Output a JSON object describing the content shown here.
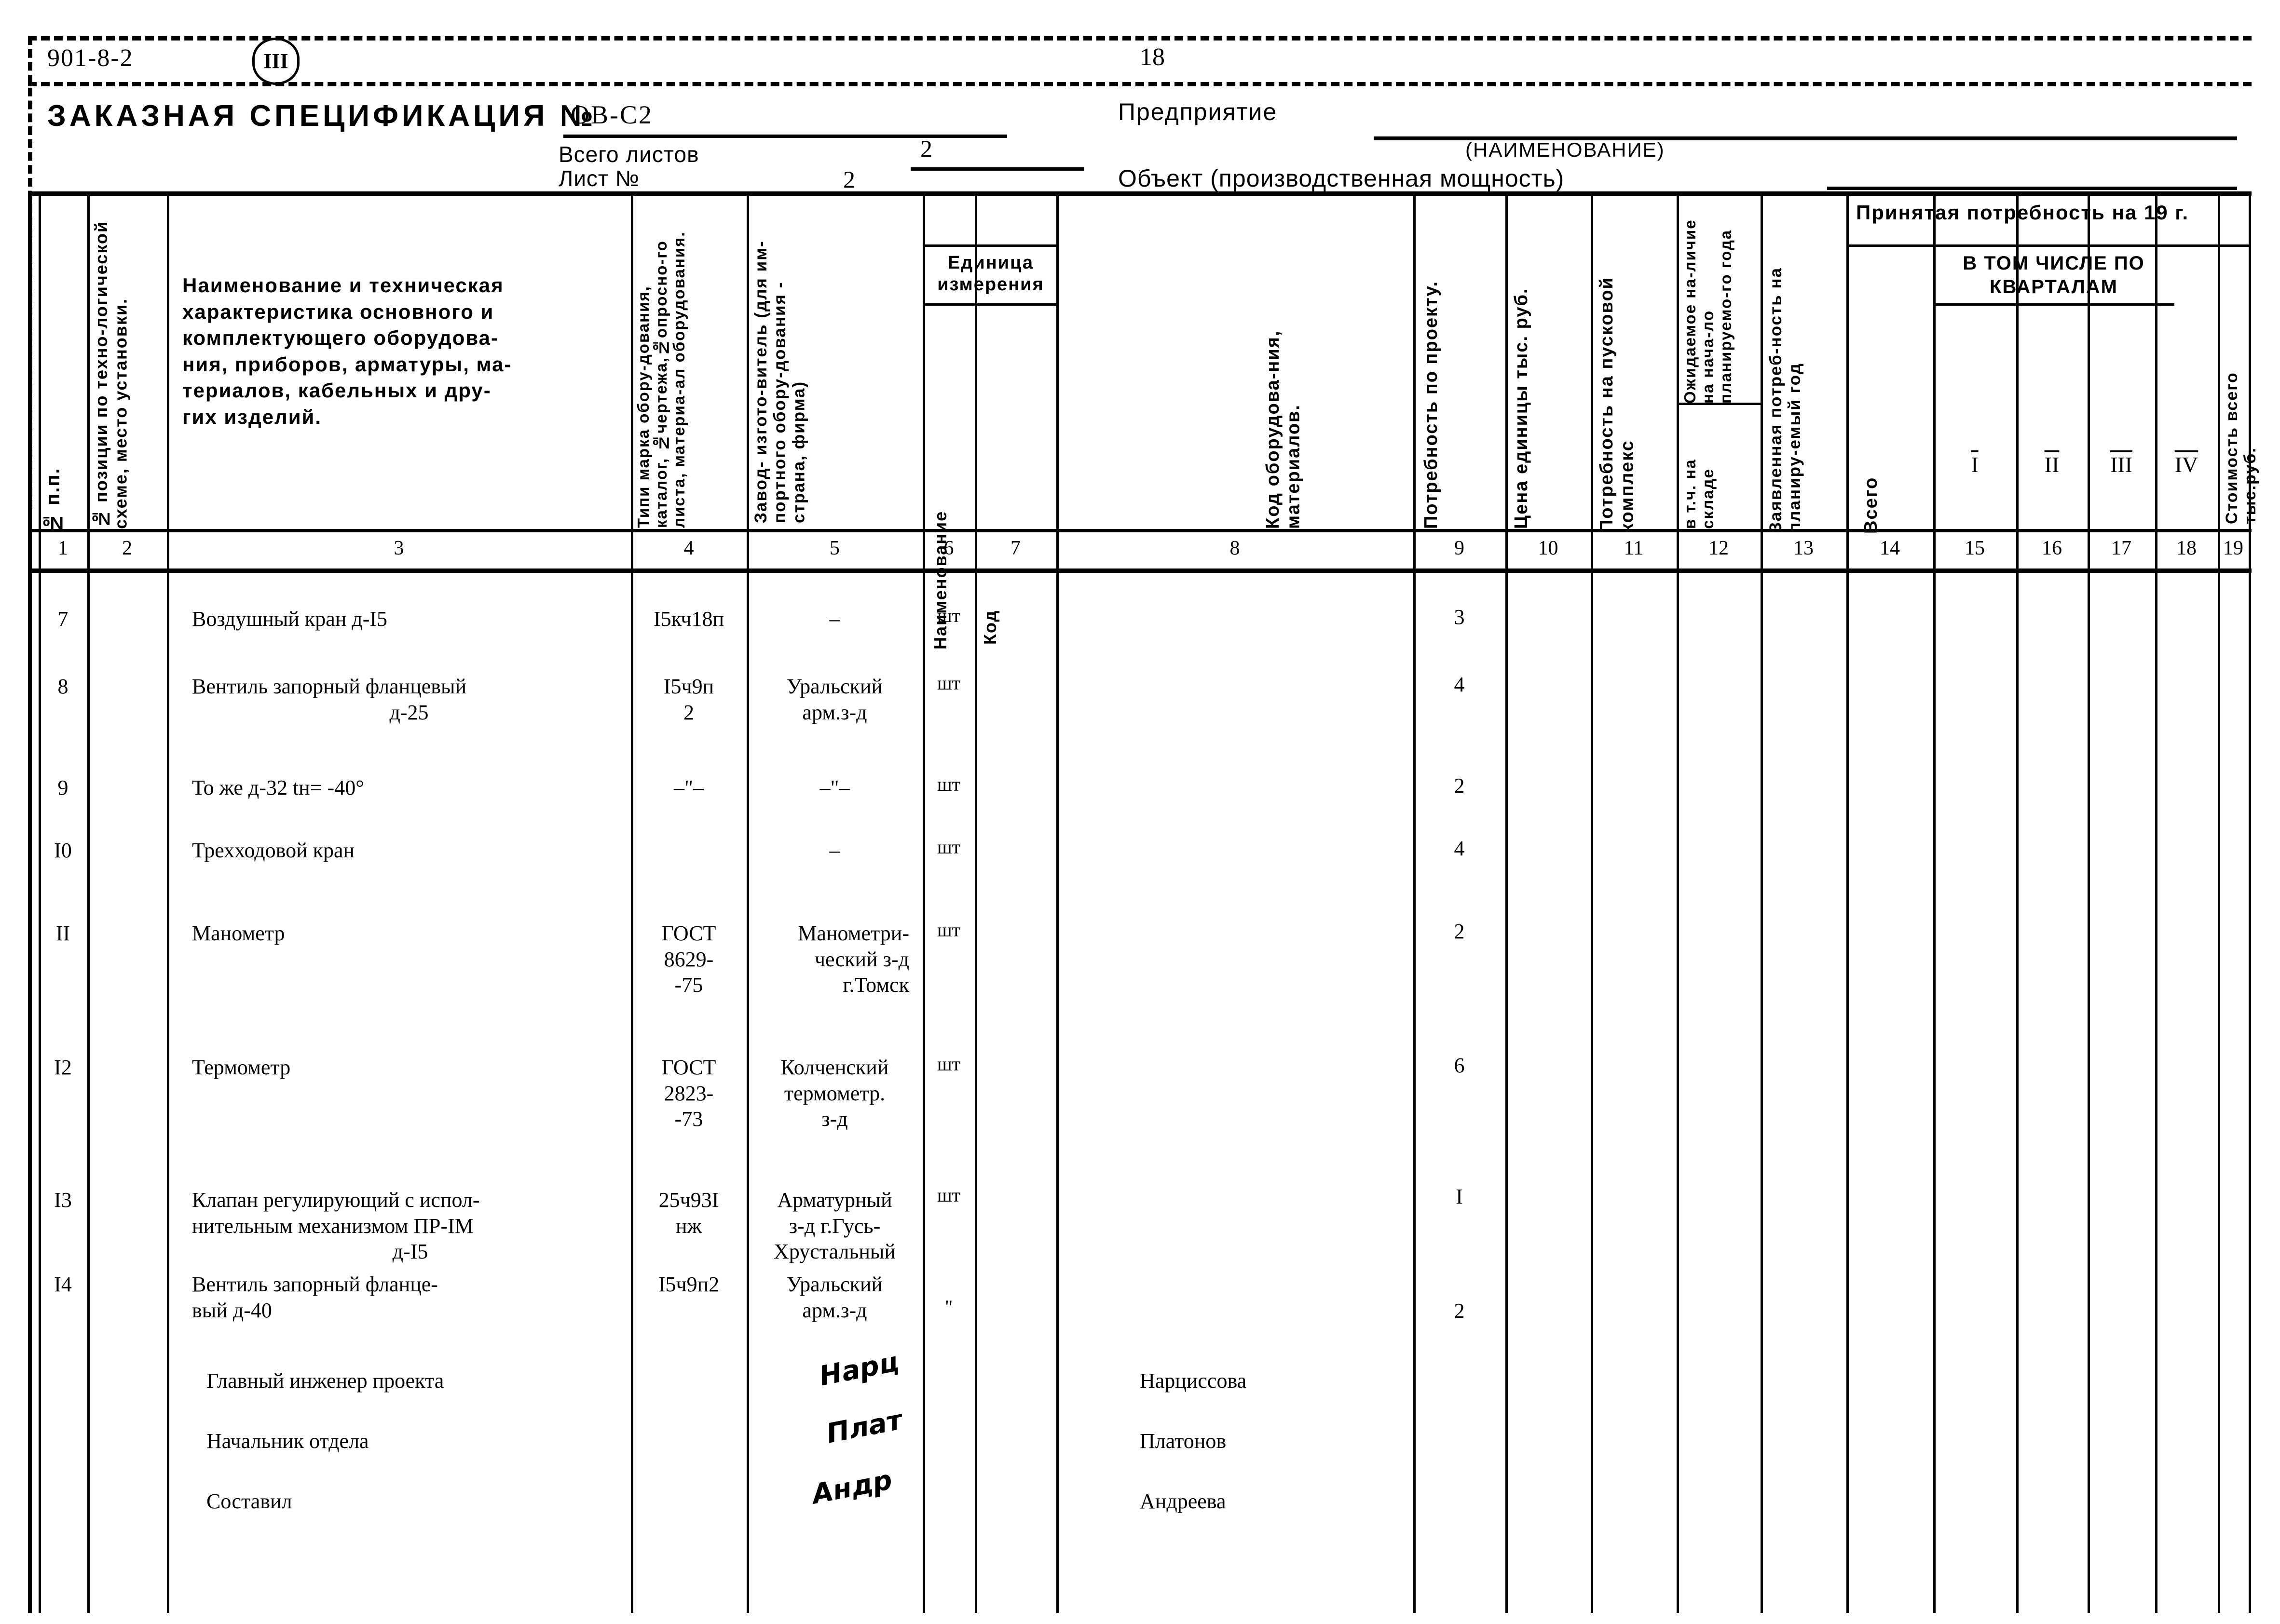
{
  "header": {
    "series_code": "901-8-2",
    "roman_mark": "III",
    "page_number": "18"
  },
  "title_block": {
    "title": "ЗАКАЗНАЯ СПЕЦИФИКАЦИЯ №",
    "spec_number": "ОВ-С2",
    "total_sheets_label": "Всего листов",
    "total_sheets_value": "2",
    "sheet_label": "Лист №",
    "sheet_value": "2",
    "enterprise_label": "Предприятие",
    "name_hint": "(НАИМЕНОВАНИЕ)",
    "object_label": "Объект (производственная мощность)"
  },
  "table": {
    "headers": {
      "c1": "№ п.п.",
      "c2": "№ позиции по техно-логической схеме, место установки.",
      "c3": "Наименование и техническая характеристика основного и комплектующего оборудова-ния, приборов, арматуры, ма-териалов, кабельных и дру-гих изделий.",
      "c3_lines": [
        "Наименование и техническая",
        "характеристика основного и",
        "комплектующего оборудова-",
        "ния, приборов, арматуры, ма-",
        "териалов, кабельных и дру-",
        "гих изделий."
      ],
      "c4": "Типи марка обору-дования, каталог, №чертежа,№опросно-го листа, материа-ал оборудования.",
      "c5": "Завод- изгото-витель (для им-портного обору-дования - страна, фирма)",
      "unit_group": "Единица измерения",
      "c6": "Наименование",
      "c7": "Код",
      "c8": "Код оборудова-ния, материалов.",
      "c9": "Потребность по проекту.",
      "c10": "Цена единицы тыс. руб.",
      "c11": "Потребность на пусковой комплекс",
      "c12": "Ожидаемое на-личие на нача-ло планируемо-го года",
      "c12b": "в т.ч. на складе",
      "c13": "Заявленная потреб-ность на планиру-емый год",
      "accepted_group": "Принятая потребность на 19          г.",
      "c14": "Всего",
      "quarters_group": "В ТОМ ЧИСЛЕ ПО КВАРТАЛАМ",
      "c15": "I",
      "c16": "II",
      "c17": "III",
      "c18": "IV",
      "c19": "Стоимость всего тыс.руб."
    },
    "column_numbers": [
      "1",
      "2",
      "3",
      "4",
      "5",
      "6",
      "7",
      "8",
      "9",
      "10",
      "11",
      "12",
      "13",
      "14",
      "15",
      "16",
      "17",
      "18",
      "19"
    ],
    "rows": [
      {
        "num": "7",
        "name": [
          "Воздушный кран д-I5"
        ],
        "type": [
          "I5кч18п"
        ],
        "maker": [
          "–"
        ],
        "unit": "шт",
        "qty": "3"
      },
      {
        "num": "8",
        "name": [
          "Вентиль запорный фланцевый",
          "д-25"
        ],
        "type": [
          "I5ч9п",
          "2"
        ],
        "maker": [
          "Уральский",
          "арм.з-д"
        ],
        "unit": "шт",
        "qty": "4"
      },
      {
        "num": "9",
        "name": [
          "То же д-32  tн= -40°"
        ],
        "type": [
          "–\"–"
        ],
        "maker": [
          "–\"–"
        ],
        "unit": "шт",
        "qty": "2"
      },
      {
        "num": "I0",
        "name": [
          "Трехходовой кран"
        ],
        "type": [
          ""
        ],
        "maker": [
          "–"
        ],
        "unit": "шт",
        "qty": "4"
      },
      {
        "num": "II",
        "name": [
          "Манометр"
        ],
        "type": [
          "ГОСТ",
          "8629-",
          "-75"
        ],
        "maker": [
          "Манометри-",
          "ческий з-д",
          "г.Томск"
        ],
        "unit": "шт",
        "qty": "2"
      },
      {
        "num": "I2",
        "name": [
          "Термометр"
        ],
        "type": [
          "ГОСТ",
          "2823-",
          "-73"
        ],
        "maker": [
          "Колченский",
          "термометр.",
          "з-д"
        ],
        "unit": "шт",
        "qty": "6"
      },
      {
        "num": "I3",
        "name": [
          "Клапан регулирующий с испол-",
          "нительным механизмом ПР-IМ",
          "д-I5"
        ],
        "type": [
          "25ч93I",
          "нж"
        ],
        "maker": [
          "Арматурный",
          "з-д г.Гусь-",
          "Хрустальный"
        ],
        "unit": "шт",
        "qty": "I"
      },
      {
        "num": "I4",
        "name": [
          "Вентиль запорный фланце-",
          "вый  д-40"
        ],
        "type": [
          "I5ч9п2"
        ],
        "maker": [
          "Уральский",
          "арм.з-д"
        ],
        "unit": "\"",
        "qty": "2"
      }
    ],
    "signatures": [
      {
        "role": "Главный  инженер проекта",
        "mark": "Нарц",
        "name": "Нарциссова"
      },
      {
        "role": "Начальник отдела",
        "mark": "Плат",
        "name": "Платонов"
      },
      {
        "role": "Составил",
        "mark": "Андр",
        "name": "Андреева"
      }
    ]
  }
}
